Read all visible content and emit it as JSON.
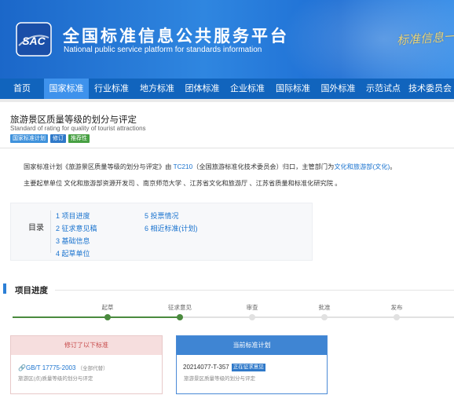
{
  "header": {
    "logo_text": "SAC",
    "title": "全国标准信息公共服务平台",
    "subtitle": "National public service platform  for standards information",
    "slogan": "标准信息一"
  },
  "nav": {
    "items": [
      {
        "label": "首页",
        "active": false
      },
      {
        "label": "国家标准",
        "active": true
      },
      {
        "label": "行业标准",
        "active": false
      },
      {
        "label": "地方标准",
        "active": false
      },
      {
        "label": "团体标准",
        "active": false
      },
      {
        "label": "企业标准",
        "active": false
      },
      {
        "label": "国际标准",
        "active": false
      },
      {
        "label": "国外标准",
        "active": false
      },
      {
        "label": "示范试点",
        "active": false
      },
      {
        "label": "技术委员会",
        "active": false
      }
    ]
  },
  "standard": {
    "title": "旅游景区质量等级的划分与评定",
    "title_en": "Standard of rating for quality of tourist attractions",
    "tags": [
      "国家标准计划",
      "修订",
      "推荐性"
    ]
  },
  "description": {
    "line1_prefix": "国家标准计划《旅游景区质量等级的划分与评定》由 ",
    "line1_tc": "TC210",
    "line1_mid": "（全国旅游标准化技术委员会）归口，主管部门为",
    "line1_dept": "文化和旅游部(文化)",
    "line1_end": "。",
    "line2": "主要起草单位 文化和旅游部资源开发司 、南京师范大学 、江苏省文化和旅游厅 、江苏省质量和标准化研究院 。"
  },
  "toc": {
    "label": "目录",
    "items": [
      "1  项目进度",
      "2  征求意见稿",
      "3  基础信息",
      "4  起草单位",
      "5  投票情况",
      "6  相近标准(计划)"
    ]
  },
  "progress": {
    "section_title": "项目进度",
    "steps": [
      {
        "label": "起草",
        "done": true
      },
      {
        "label": "征求意见",
        "done": true
      },
      {
        "label": "审查",
        "done": false
      },
      {
        "label": "批准",
        "done": false
      },
      {
        "label": "发布",
        "done": false
      }
    ]
  },
  "cards": {
    "left_title": "修订了以下标准",
    "left_code": "GB/T 17775-2003",
    "left_code_note": "（全部代替）",
    "left_name": "旅游区(点)质量等级的划分与评定",
    "right_title": "当前标准计划",
    "right_code": "20214077-T-357",
    "right_badge": "正在征求意见",
    "right_name": "旅游景区质量等级的划分与评定"
  },
  "colors": {
    "brand": "#1164bd",
    "nav_active": "#3e92ec",
    "link": "#1a73cf",
    "done_step": "#4a8a3e"
  }
}
